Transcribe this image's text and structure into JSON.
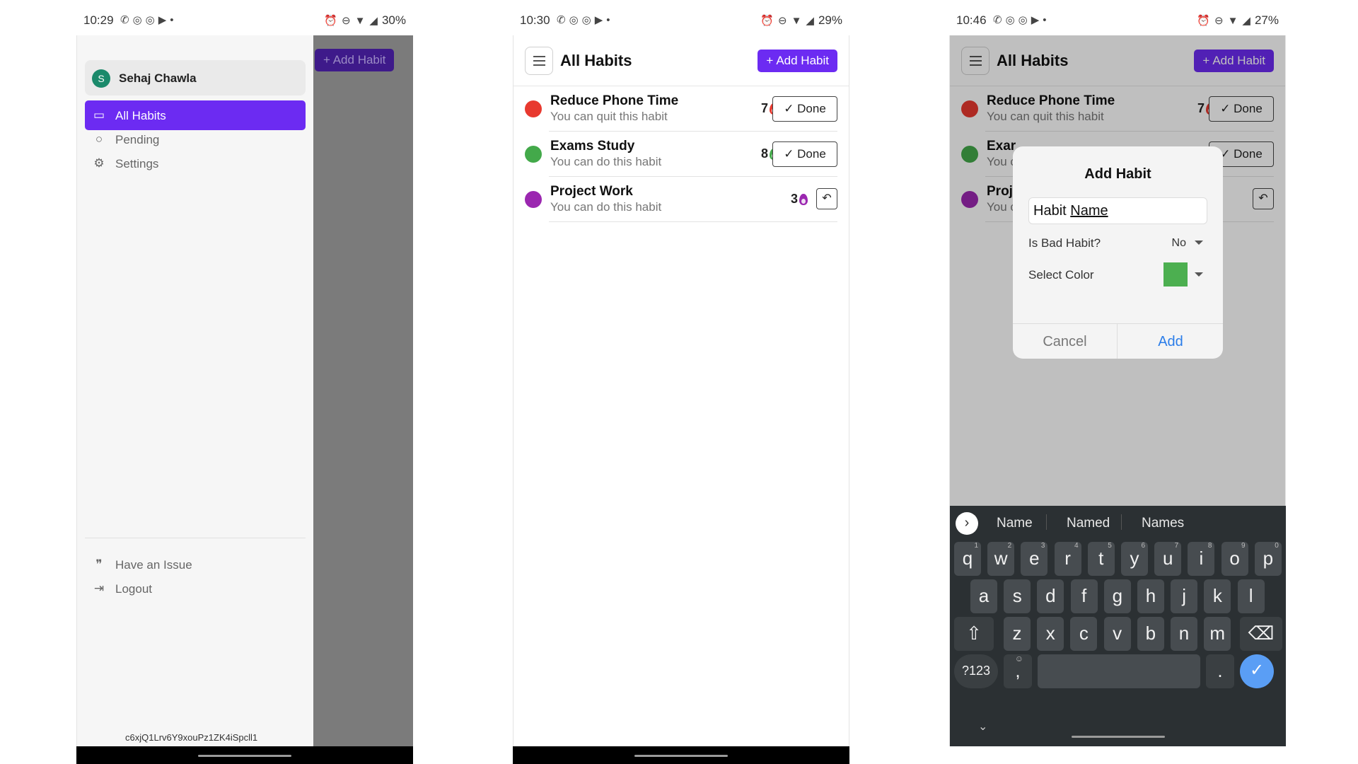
{
  "screens": [
    {
      "status": {
        "time": "10:29",
        "battery": "30%"
      },
      "drawer": {
        "user_initial": "S",
        "user_name": "Sehaj Chawla",
        "items": [
          {
            "label": "All Habits",
            "icon": "calendar-icon",
            "active": true
          },
          {
            "label": "Pending",
            "icon": "circle-icon",
            "active": false
          },
          {
            "label": "Settings",
            "icon": "gear-icon",
            "active": false
          }
        ],
        "footer": [
          {
            "label": "Have an Issue",
            "icon": "quote-icon"
          },
          {
            "label": "Logout",
            "icon": "logout-icon"
          }
        ],
        "user_id": "c6xjQ1Lrv6Y9xouPz1ZK4iSpcll1"
      },
      "overlay_button": "Add Habit"
    },
    {
      "status": {
        "time": "10:30",
        "battery": "29%"
      },
      "header": {
        "title": "All Habits",
        "add_button": "Add Habit"
      },
      "habits": [
        {
          "name": "Reduce Phone Time",
          "subtitle": "You can quit this habit",
          "color": "#e8392f",
          "streak": "7",
          "action": "Done"
        },
        {
          "name": "Exams Study",
          "subtitle": "You can do this habit",
          "color": "#43a94a",
          "streak": "8",
          "action": "Done"
        },
        {
          "name": "Project Work",
          "subtitle": "You can do this habit",
          "color": "#9b27b0",
          "streak": "3",
          "action": "undo"
        }
      ]
    },
    {
      "status": {
        "time": "10:46",
        "battery": "27%"
      },
      "header": {
        "title": "All Habits",
        "add_button": "Add Habit"
      },
      "habits": [
        {
          "name": "Reduce Phone Time",
          "subtitle": "You can quit this habit",
          "color": "#e8392f",
          "streak": "7",
          "action": "Done"
        },
        {
          "name": "Exar",
          "subtitle": "You c",
          "color": "#43a94a",
          "streak": "",
          "action": "Done"
        },
        {
          "name": "Proj",
          "subtitle": "You c",
          "color": "#9b27b0",
          "streak": "",
          "action": "undo"
        }
      ],
      "dialog": {
        "title": "Add Habit",
        "input_prefix": "Habit ",
        "input_underlined": "Name",
        "bad_habit_label": "Is Bad Habit?",
        "bad_habit_value": "No",
        "color_label": "Select Color",
        "color_value": "#4caf50",
        "cancel": "Cancel",
        "add": "Add"
      },
      "keyboard": {
        "suggestions": [
          "Name",
          "Named",
          "Names"
        ],
        "row1": [
          [
            "q",
            "1"
          ],
          [
            "w",
            "2"
          ],
          [
            "e",
            "3"
          ],
          [
            "r",
            "4"
          ],
          [
            "t",
            "5"
          ],
          [
            "y",
            "6"
          ],
          [
            "u",
            "7"
          ],
          [
            "i",
            "8"
          ],
          [
            "o",
            "9"
          ],
          [
            "p",
            "0"
          ]
        ],
        "row2": [
          "a",
          "s",
          "d",
          "f",
          "g",
          "h",
          "j",
          "k",
          "l"
        ],
        "row3": [
          "z",
          "x",
          "c",
          "v",
          "b",
          "n",
          "m"
        ],
        "symbols_key": "?123",
        "comma_key": ",",
        "period_key": "."
      }
    }
  ]
}
